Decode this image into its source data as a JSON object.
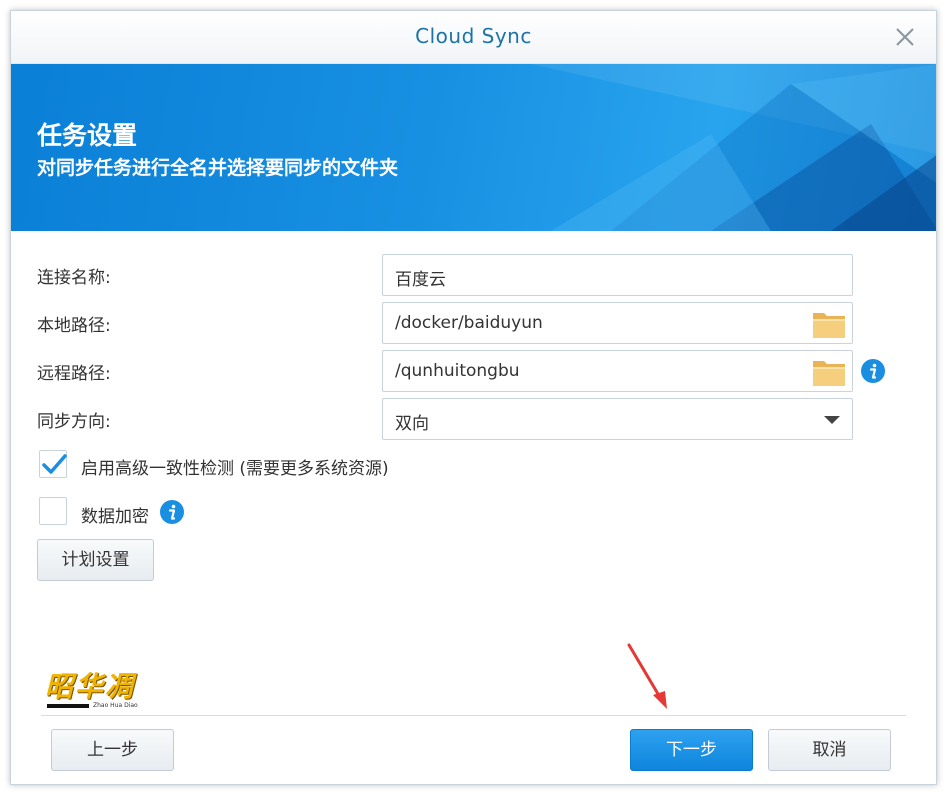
{
  "window": {
    "title": "Cloud Sync"
  },
  "banner": {
    "title": "任务设置",
    "subtitle": "对同步任务进行全名并选择要同步的文件夹"
  },
  "form": {
    "connection_name": {
      "label": "连接名称:",
      "value": "百度云"
    },
    "local_path": {
      "label": "本地路径:",
      "value": "/docker/baiduyun"
    },
    "remote_path": {
      "label": "远程路径:",
      "value": "/qunhuitongbu"
    },
    "sync_direction": {
      "label": "同步方向:",
      "value": "双向"
    },
    "advanced_check": {
      "label": "启用高级一致性检测 (需要更多系统资源)",
      "checked": true
    },
    "data_encryption": {
      "label": "数据加密",
      "checked": false
    },
    "schedule_button": "计划设置"
  },
  "footer": {
    "prev": "上一步",
    "next": "下一步",
    "cancel": "取消"
  },
  "watermark": {
    "text": "昭华凋",
    "sub": "Zhao Hua Diao"
  },
  "colors": {
    "accent": "#1890e2",
    "title": "#1c73a8",
    "info": "#1a8ee0",
    "folder": "#f3c66c"
  }
}
